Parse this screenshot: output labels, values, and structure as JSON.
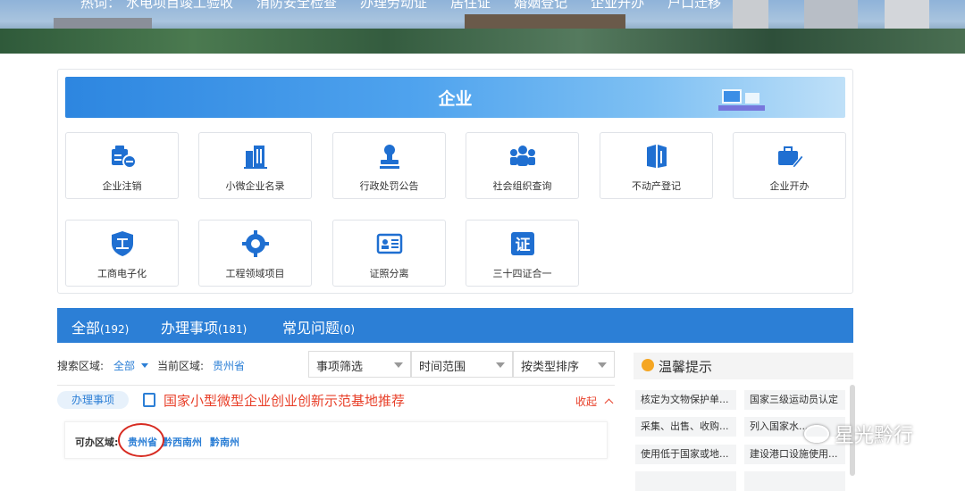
{
  "header": {
    "hot_label": "热词：",
    "hot_words": [
      "水电项目竣工验收",
      "消防安全检查",
      "办理劳动证",
      "居住证",
      "婚姻登记",
      "企业开办",
      "户口迁移"
    ]
  },
  "section": {
    "title": "企业",
    "tiles": [
      {
        "label": "企业注销",
        "icon": "enterprise-cancel-icon"
      },
      {
        "label": "小微企业名录",
        "icon": "building-icon"
      },
      {
        "label": "行政处罚公告",
        "icon": "stamp-icon"
      },
      {
        "label": "社会组织查询",
        "icon": "people-group-icon"
      },
      {
        "label": "不动产登记",
        "icon": "real-estate-icon"
      },
      {
        "label": "企业开办",
        "icon": "briefcase-pen-icon"
      },
      {
        "label": "工商电子化",
        "icon": "shield-gong-icon"
      },
      {
        "label": "工程领域项目",
        "icon": "gear-icon"
      },
      {
        "label": "证照分离",
        "icon": "id-card-icon"
      },
      {
        "label": "三十四证合一",
        "icon": "certificate-icon"
      }
    ]
  },
  "tabs": [
    {
      "label": "全部",
      "count": "(192)"
    },
    {
      "label": "办理事项",
      "count": "(181)"
    },
    {
      "label": "常见问题",
      "count": "(0)"
    }
  ],
  "filters": {
    "search_area_label": "搜索区域:",
    "search_area_value": "全部",
    "current_area_label": "当前区域:",
    "current_area_value": "贵州省",
    "selects": [
      "事项筛选",
      "时间范围",
      "按类型排序"
    ]
  },
  "item": {
    "tag": "办理事项",
    "title": "国家小型微型企业创业创新示范基地推荐",
    "collapse": "收起",
    "area_label": "可办区域:",
    "areas": [
      "贵州省",
      "黔西南州",
      "黔南州"
    ]
  },
  "tips": {
    "title": "温馨提示",
    "items": [
      "核定为文物保护单...",
      "国家三级运动员认定",
      "采集、出售、收购...",
      "列入国家水...",
      "使用低于国家或地...",
      "建设港口设施使用..."
    ]
  },
  "watermark": "星光黔行",
  "colors": {
    "primary": "#2c7fd6",
    "alert": "#e8402a",
    "circle": "#d72b21"
  }
}
